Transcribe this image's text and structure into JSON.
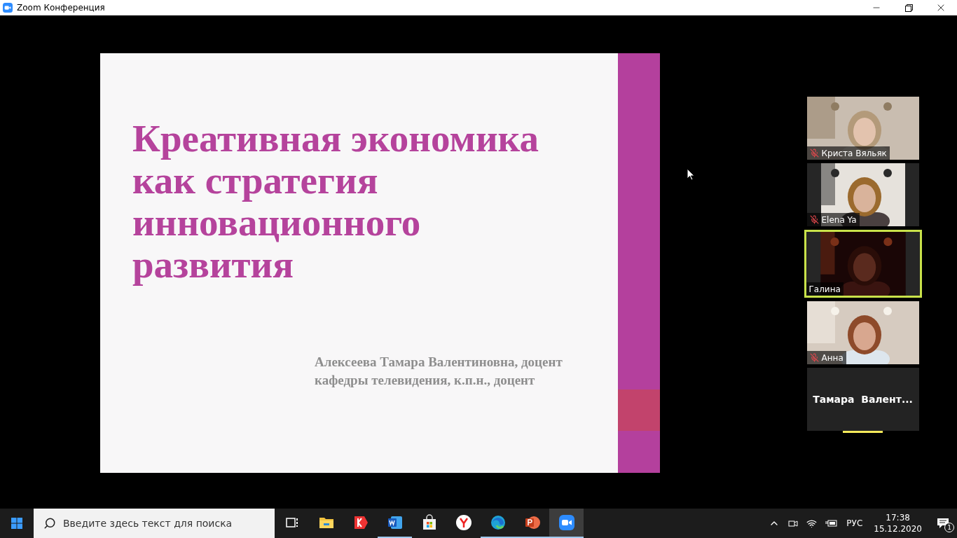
{
  "window": {
    "title": "Zoom Конференция"
  },
  "slide": {
    "title_lines": [
      "Креативная экономика",
      "как стратегия",
      "инновационного",
      "развития"
    ],
    "author_lines": [
      "Алексеева Тамара Валентиновна, доцент",
      "кафедры телевидения, к.п.н., доцент"
    ]
  },
  "participants": [
    {
      "kind": "video",
      "name": "Криста Вяльяк",
      "muted": true,
      "speaking": false
    },
    {
      "kind": "video",
      "name": "Elena Ya",
      "muted": true,
      "speaking": false
    },
    {
      "kind": "video",
      "name": "Галина",
      "muted": false,
      "speaking": true
    },
    {
      "kind": "video",
      "name": "Анна",
      "muted": true,
      "speaking": false
    },
    {
      "kind": "name",
      "name": "Тамара  Валент...",
      "muted": false,
      "speaking": false
    }
  ],
  "taskbar": {
    "search": {
      "placeholder": "Введите здесь текст для поиска"
    },
    "apps": [
      {
        "kind": "task-view",
        "running": false,
        "selected": false
      },
      {
        "kind": "folder",
        "running": false,
        "selected": false
      },
      {
        "kind": "yandex-browser",
        "running": false,
        "selected": false
      },
      {
        "kind": "word",
        "running": true,
        "selected": false
      },
      {
        "kind": "store",
        "running": false,
        "selected": false
      },
      {
        "kind": "yandex",
        "running": false,
        "selected": false
      },
      {
        "kind": "edge",
        "running": true,
        "selected": false
      },
      {
        "kind": "powerpoint",
        "running": true,
        "selected": false
      },
      {
        "kind": "zoom",
        "running": true,
        "selected": true
      }
    ],
    "tray": {
      "language": "РУС",
      "time": "17:38",
      "date": "15.12.2020",
      "notifications": "1"
    }
  }
}
